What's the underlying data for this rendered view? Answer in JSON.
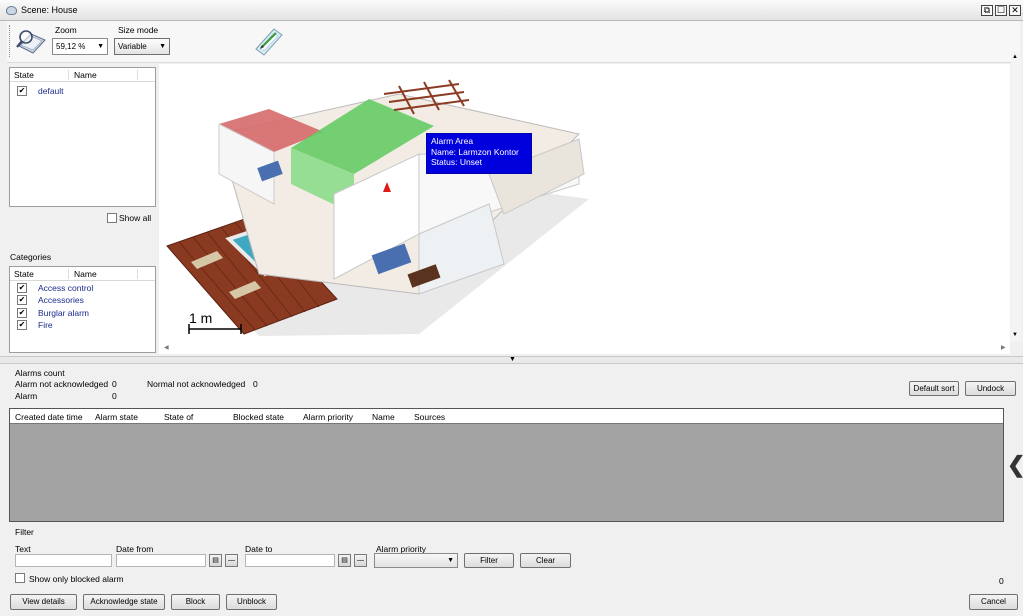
{
  "window": {
    "title": "Scene: House",
    "buttons": [
      "⧉",
      "☐",
      "✕"
    ]
  },
  "toolbar": {
    "zoom_label": "Zoom",
    "zoom_value": "59,12 %",
    "size_mode_label": "Size mode",
    "size_mode_value": "Variable"
  },
  "states_panel": {
    "col_state": "State",
    "col_name": "Name",
    "items": [
      {
        "name": "default",
        "checked": true
      }
    ],
    "show_all_label": "Show all"
  },
  "categories_panel": {
    "title": "Categories",
    "col_state": "State",
    "col_name": "Name",
    "items": [
      {
        "name": "Access control",
        "checked": true
      },
      {
        "name": "Accessories",
        "checked": true
      },
      {
        "name": "Burglar alarm",
        "checked": true
      },
      {
        "name": "Fire",
        "checked": true
      }
    ]
  },
  "scene": {
    "tooltip": {
      "line1": "Alarm Area",
      "line2": "Name: Larmzon Kontor",
      "line3": "Status: Unset"
    },
    "scale_label": "1 m"
  },
  "alarms": {
    "count_title": "Alarms count",
    "rows": [
      {
        "label": "Alarm not acknowledged",
        "value": "0"
      },
      {
        "label": "Alarm",
        "value": "0"
      }
    ],
    "normal_label": "Normal not acknowledged",
    "normal_value": "0",
    "default_sort_label": "Default sort",
    "undock_label": "Undock",
    "columns": [
      "Created date time",
      "Alarm state",
      "State of",
      "Blocked state",
      "Alarm priority",
      "Name",
      "Sources"
    ]
  },
  "filter": {
    "title": "Filter",
    "text_label": "Text",
    "date_from_label": "Date from",
    "date_to_label": "Date to",
    "priority_label": "Alarm priority",
    "filter_button": "Filter",
    "clear_button": "Clear",
    "show_blocked_label": "Show only blocked alarm",
    "count_value": "0"
  },
  "actions": {
    "view_details": "View details",
    "acknowledge_state": "Acknowledge state",
    "block": "Block",
    "unblock": "Unblock",
    "cancel": "Cancel"
  },
  "colors": {
    "tooltip_bg": "#0000dd",
    "green_room": "#66cc66",
    "red_room": "#d66a6a",
    "pool": "#4fb6c6"
  }
}
